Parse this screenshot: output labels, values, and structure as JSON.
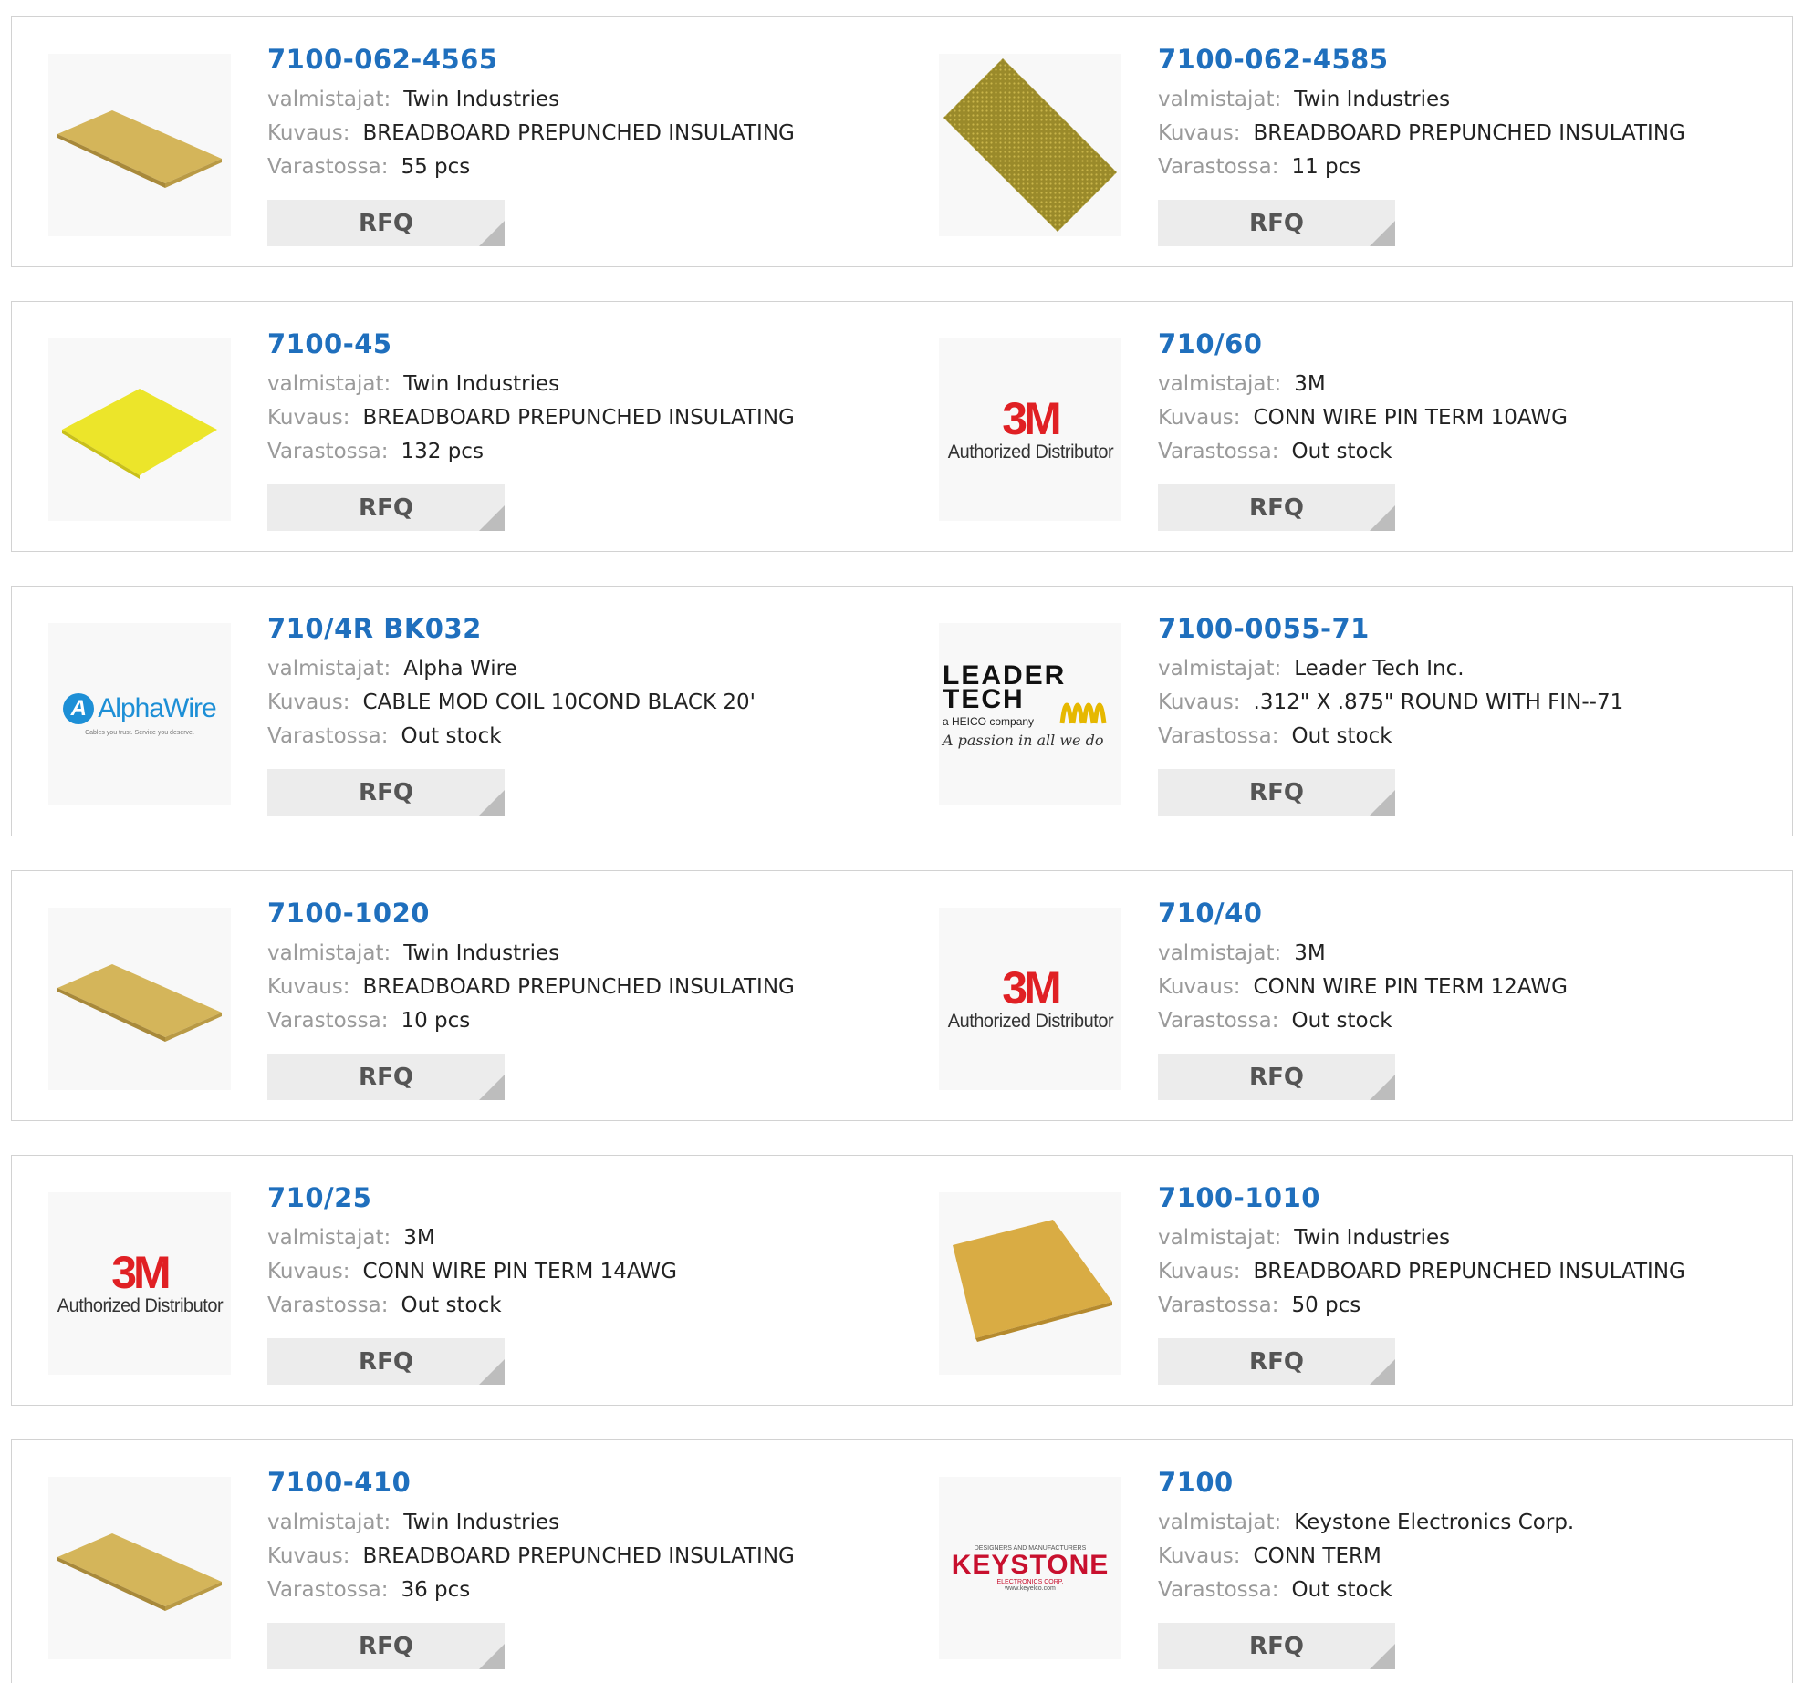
{
  "labels": {
    "manufacturer": "valmistajat:",
    "description": "Kuvaus:",
    "stock": "Varastossa:",
    "rfq": "RFQ"
  },
  "brand": {
    "authorized": "Authorized Distributor",
    "m3": "3M",
    "alpha_name": "AlphaWire",
    "alpha_tag": "Cables you trust. Service you deserve.",
    "leader_line1": "LEADER",
    "leader_line2": "TECH",
    "leader_sub": "a HEICO company",
    "leader_script": "A passion in all we do",
    "key_top": "DESIGNERS AND MANUFACTURERS",
    "key_name": "KEYSTONE",
    "key_sub": "ELECTRONICS CORP.",
    "key_url": "www.keyelco.com"
  },
  "colors": {
    "link": "#1f6fbd",
    "label": "#9a9a9a",
    "button_bg": "#ececec",
    "brand_3m": "#e02024",
    "alpha": "#1d8fd6",
    "keystone": "#c8102e"
  },
  "products": [
    {
      "part": "7100-062-4565",
      "manufacturer": "Twin Industries",
      "description": "BREADBOARD PREPUNCHED INSULATING",
      "stock": "55 pcs",
      "image": "board-gold"
    },
    {
      "part": "7100-062-4585",
      "manufacturer": "Twin Industries",
      "description": "BREADBOARD PREPUNCHED INSULATING",
      "stock": "11 pcs",
      "image": "board-perforated"
    },
    {
      "part": "7100-45",
      "manufacturer": "Twin Industries",
      "description": "BREADBOARD PREPUNCHED INSULATING",
      "stock": "132 pcs",
      "image": "board-yellow"
    },
    {
      "part": "710/60",
      "manufacturer": "3M",
      "description": "CONN WIRE PIN TERM 10AWG",
      "stock": "Out stock",
      "image": "logo-3m"
    },
    {
      "part": "710/4R BK032",
      "manufacturer": "Alpha Wire",
      "description": "CABLE MOD COIL 10COND BLACK 20'",
      "stock": "Out stock",
      "image": "logo-alphawire"
    },
    {
      "part": "7100-0055-71",
      "manufacturer": "Leader Tech Inc.",
      "description": ".312\" X .875\" ROUND WITH FIN--71",
      "stock": "Out stock",
      "image": "logo-leadertech"
    },
    {
      "part": "7100-1020",
      "manufacturer": "Twin Industries",
      "description": "BREADBOARD PREPUNCHED INSULATING",
      "stock": "10 pcs",
      "image": "board-gold"
    },
    {
      "part": "710/40",
      "manufacturer": "3M",
      "description": "CONN WIRE PIN TERM 12AWG",
      "stock": "Out stock",
      "image": "logo-3m"
    },
    {
      "part": "710/25",
      "manufacturer": "3M",
      "description": "CONN WIRE PIN TERM 14AWG",
      "stock": "Out stock",
      "image": "logo-3m"
    },
    {
      "part": "7100-1010",
      "manufacturer": "Twin Industries",
      "description": "BREADBOARD PREPUNCHED INSULATING",
      "stock": "50 pcs",
      "image": "board-amber"
    },
    {
      "part": "7100-410",
      "manufacturer": "Twin Industries",
      "description": "BREADBOARD PREPUNCHED INSULATING",
      "stock": "36 pcs",
      "image": "board-gold"
    },
    {
      "part": "7100",
      "manufacturer": "Keystone Electronics Corp.",
      "description": "CONN TERM",
      "stock": "Out stock",
      "image": "logo-keystone"
    }
  ]
}
